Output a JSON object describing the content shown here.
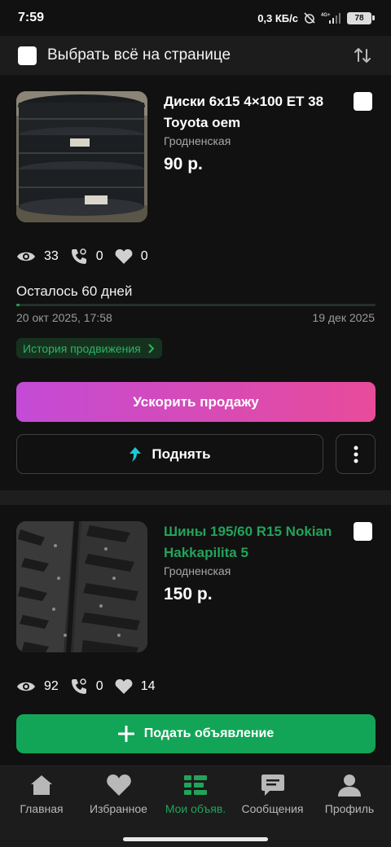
{
  "status_bar": {
    "time": "7:59",
    "speed": "0,3 КБ/с",
    "battery": "78"
  },
  "select_bar": {
    "label": "Выбрать всё на странице"
  },
  "listings": [
    {
      "title": "Диски 6х15 4×100 ET 38 Toyota oem",
      "region": "Гродненская",
      "price": "90 р.",
      "views": "33",
      "calls": "0",
      "likes": "0",
      "remaining": "Осталось 60 дней",
      "remaining_fraction": 0.01,
      "date_start": "20 окт 2025, 17:58",
      "date_end": "19 дек 2025",
      "history_label": "История продвижения",
      "boost_label": "Ускорить продажу",
      "raise_label": "Поднять"
    },
    {
      "title": "Шины 195/60 R15 Nokian Hakkapilita 5",
      "region": "Гродненская",
      "price": "150 р.",
      "views": "92",
      "calls": "0",
      "likes": "14"
    }
  ],
  "post_button": {
    "label": "Подать объявление"
  },
  "bottom_nav": {
    "items": [
      {
        "label": "Главная",
        "icon": "home-icon"
      },
      {
        "label": "Избранное",
        "icon": "heart-icon"
      },
      {
        "label": "Мои объяв.",
        "icon": "my-ads-icon",
        "active": true
      },
      {
        "label": "Сообщения",
        "icon": "message-icon"
      },
      {
        "label": "Профиль",
        "icon": "profile-icon"
      }
    ]
  },
  "colors": {
    "accent_green": "#22a35a",
    "boost_gradient_start": "#c34bd6",
    "boost_gradient_end": "#e84b9a",
    "background": "#111111"
  }
}
